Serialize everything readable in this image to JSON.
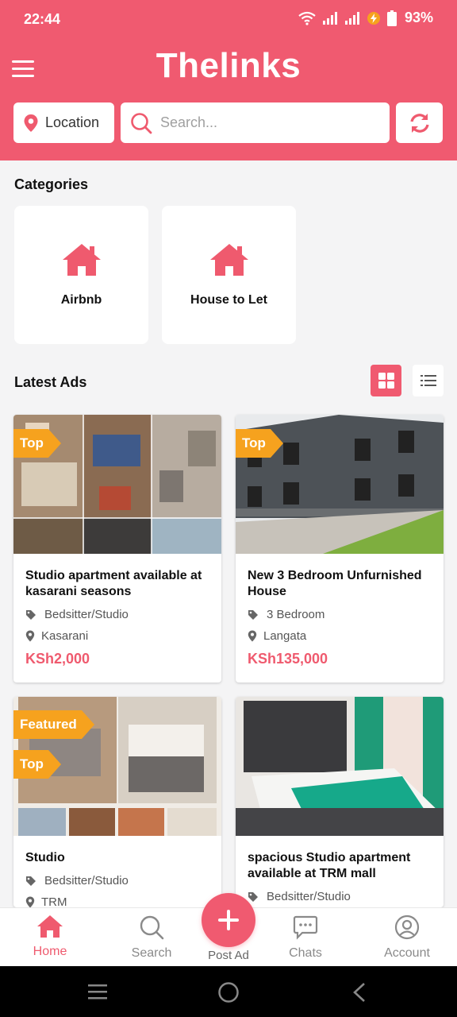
{
  "status_bar": {
    "time": "22:44",
    "battery": "93%"
  },
  "header": {
    "app_title": "Thelinks",
    "location_label": "Location",
    "search_placeholder": "Search..."
  },
  "categories": {
    "title": "Categories",
    "items": [
      {
        "label": "Airbnb",
        "icon": "house-icon"
      },
      {
        "label": "House to Let",
        "icon": "house-icon"
      }
    ]
  },
  "latest_ads": {
    "title": "Latest Ads",
    "view_mode": "grid",
    "items": [
      {
        "badges": [
          "Top"
        ],
        "title": "Studio apartment available at kasarani seasons",
        "category": "Bedsitter/Studio",
        "location": "Kasarani",
        "price": "KSh2,000"
      },
      {
        "badges": [
          "Top"
        ],
        "title": "New 3 Bedroom Unfurnished House",
        "category": "3 Bedroom",
        "location": "Langata",
        "price": "KSh135,000"
      },
      {
        "badges": [
          "Featured",
          "Top"
        ],
        "title": "Studio",
        "category": "Bedsitter/Studio",
        "location": "TRM",
        "price": ""
      },
      {
        "badges": [],
        "title": "spacious Studio apartment available at TRM mall",
        "category": "Bedsitter/Studio",
        "location": "",
        "price": ""
      }
    ]
  },
  "bottom_nav": {
    "items": [
      {
        "label": "Home",
        "icon": "home-icon",
        "active": true
      },
      {
        "label": "Search",
        "icon": "search-icon",
        "active": false
      },
      {
        "label": "Post Ad",
        "icon": "plus-icon",
        "active": false
      },
      {
        "label": "Chats",
        "icon": "chat-icon",
        "active": false
      },
      {
        "label": "Account",
        "icon": "account-icon",
        "active": false
      }
    ]
  },
  "colors": {
    "brand": "#f05a70",
    "badge": "#f6a21e",
    "price": "#ef5a6e"
  }
}
